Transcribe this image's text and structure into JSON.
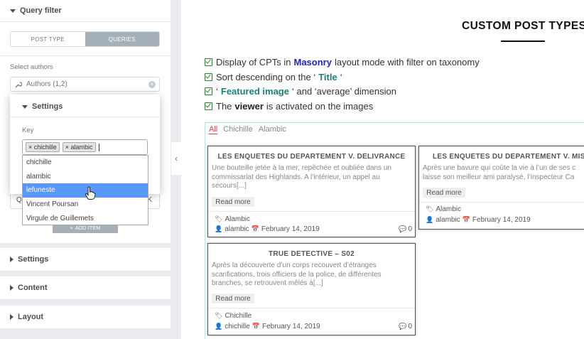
{
  "panel": {
    "query_filter": "Query filter",
    "tabs": [
      "POST TYPE",
      "QUERIES"
    ],
    "select_authors_label": "Select authors",
    "authors_value": "Authors (1,2)",
    "popover": {
      "settings_label": "Settings",
      "key_label": "Key",
      "tags": [
        "chichille",
        "alambic"
      ]
    },
    "dropdown_options": [
      "chichille",
      "alambic",
      "lefuneste",
      "Vincent Poursan",
      "Virgule de Guillemets"
    ],
    "highlighted_option": "lefuneste",
    "add_item": "ADD ITEM",
    "sections": [
      "Settings",
      "Content",
      "Layout"
    ],
    "partial_left": "Q",
    "partial_right": "K"
  },
  "main": {
    "title": "CUSTOM POST TYPES",
    "features": [
      {
        "pre": "Display of CPTs in ",
        "em": "Masonry",
        "post": " layout mode with filter on taxonomy"
      },
      {
        "pre": "Sort descending on the ‘",
        "em": "Title",
        "post": "‘"
      },
      {
        "pre": "‘",
        "em": "Featured image",
        "post": "‘ and ‘average’ dimension"
      },
      {
        "pre": "The ",
        "em": "viewer",
        "post": " is activated on the images"
      }
    ],
    "filters": [
      "All",
      "Chichille",
      "Alambic"
    ],
    "cards": [
      {
        "title": "LES ENQUÊTES DU DÉPARTEMENT V. DÉLIVRANCE",
        "excerpt": "Une bouteille jetée à la mer, repêchée et oubliée dans un commissariat des Highlands. A l’intérieur, un appel au secours[...]",
        "read_more": "Read more",
        "taxonomy": "Alambic",
        "author": "alambic",
        "date": "February 14, 2019",
        "comments": "0"
      },
      {
        "title": "LES ENQUÊTES DU DÉPARTEMENT V. MISÉ",
        "excerpt": "Après une bavure qui coûte la vie à l’un de ses c laisse son meilleur ami paralysé, l’inspecteur Ca",
        "read_more": "Read more",
        "taxonomy": "Alambic",
        "author": "alambic",
        "date": "February 14, 2019",
        "comments": ""
      },
      {
        "title": "TRUE DETECTIVE – S02",
        "excerpt": "Après la découverte d’un corps recouvert d’étranges scarifications, trois officiers de la police, de différentes branches, se retrouvent mêlés à[...]",
        "read_more": "Read more",
        "taxonomy": "Chichille",
        "author": "chichille",
        "date": "February 14, 2019",
        "comments": "0"
      }
    ]
  },
  "colors": {
    "masonry": "#2222cc",
    "teal": "#1a7f7a",
    "active_filter": "#e04040",
    "highlight": "#5897fb"
  }
}
